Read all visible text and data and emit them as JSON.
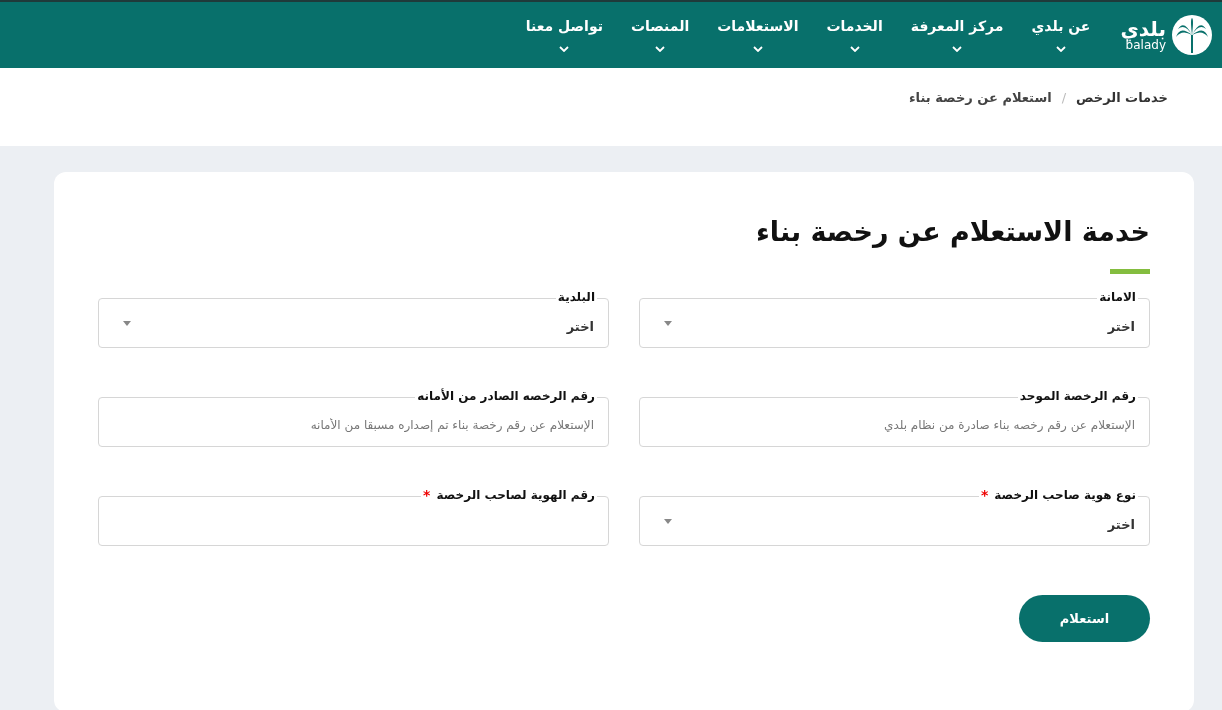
{
  "logo": {
    "arabic": "بلدي",
    "latin": "balady"
  },
  "nav": [
    {
      "label": "عن بلدي"
    },
    {
      "label": "مركز المعرفة"
    },
    {
      "label": "الخدمات"
    },
    {
      "label": "الاستعلامات"
    },
    {
      "label": "المنصات"
    },
    {
      "label": "تواصل معنا"
    }
  ],
  "breadcrumb": {
    "separator": "/",
    "items": [
      {
        "label": "خدمات الرخص"
      },
      {
        "label": "استعلام عن رخصة بناء"
      }
    ]
  },
  "form": {
    "title": "خدمة الاستعلام عن رخصة بناء",
    "required_mark": "*",
    "fields": [
      {
        "kind": "select",
        "label": "الامانة",
        "required": false,
        "value": "اختر"
      },
      {
        "kind": "select",
        "label": "البلدية",
        "required": false,
        "value": "اختر"
      },
      {
        "kind": "text",
        "label": "رقم الرخصة الموحد",
        "required": false,
        "placeholder": "الإستعلام عن رقم رخصه بناء صادرة من نظام بلدي"
      },
      {
        "kind": "text",
        "label": "رقم الرخصه الصادر من الأمانه",
        "required": false,
        "placeholder": "الإستعلام عن رقم رخصة بناء تم إصداره مسبقا من الأمانه"
      },
      {
        "kind": "select",
        "label": "نوع هوية صاحب الرخصة",
        "required": true,
        "value": "اختر"
      },
      {
        "kind": "text",
        "label": "رقم الهوية لصاحب الرخصة",
        "required": true
      }
    ],
    "submit": "استعلام"
  }
}
